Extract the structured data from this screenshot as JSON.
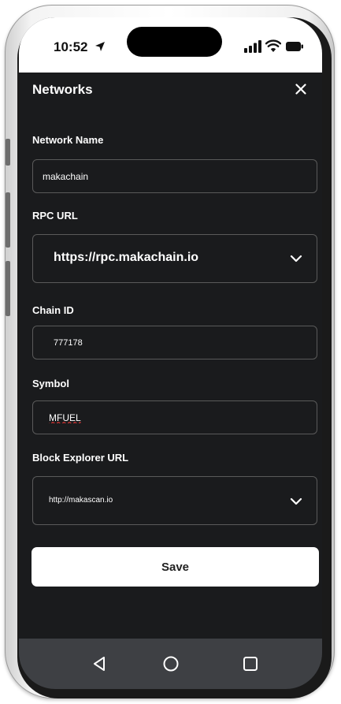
{
  "status_bar": {
    "time": "10:52"
  },
  "header": {
    "title": "Networks"
  },
  "form": {
    "network_name": {
      "label": "Network Name",
      "value": "makachain"
    },
    "rpc_url": {
      "label": "RPC URL",
      "value": "https://rpc.makachain.io"
    },
    "chain_id": {
      "label": "Chain ID",
      "value": "777178"
    },
    "symbol": {
      "label": "Symbol",
      "value": "MFUEL"
    },
    "block_explorer_url": {
      "label": "Block Explorer URL",
      "value": "http://makascan.io"
    },
    "save_label": "Save"
  },
  "icons": {
    "close": "close-icon",
    "chevron": "chevron-down-icon",
    "nav_back": "triangle-back-icon",
    "nav_home": "circle-home-icon",
    "nav_recents": "square-recents-icon"
  },
  "colors": {
    "screen_bg": "#1a1b1d",
    "field_border": "#5a5a5a",
    "nav_bar": "#3e4044",
    "button_bg": "#ffffff"
  }
}
